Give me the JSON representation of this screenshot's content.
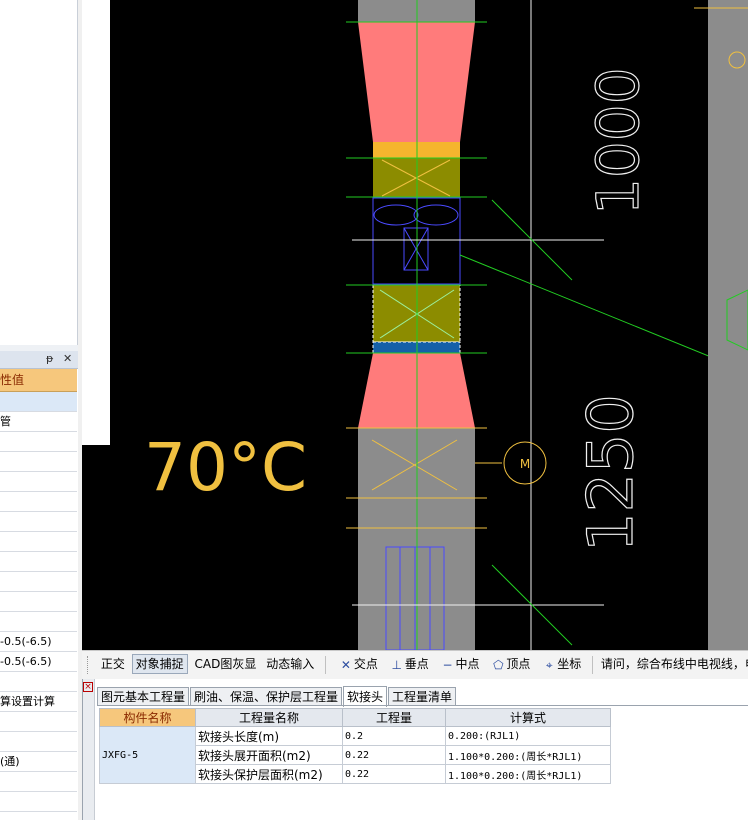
{
  "left_panel": {
    "title_pin_icon": "pin-icon",
    "title_close_icon": "close-icon",
    "title_pin_glyph": "ᵽ",
    "title_close_glyph": "✕",
    "header": "属性值",
    "rows": [
      "",
      "管",
      "",
      "",
      "",
      "",
      "",
      "",
      "",
      "",
      "",
      "",
      "-0.5(-6.5)",
      "-0.5(-6.5)",
      "",
      "算设置计算",
      "",
      "",
      "(通)",
      "",
      ""
    ]
  },
  "canvas": {
    "temp_label": "70°C",
    "dim_upper": "1000",
    "dim_lower": "1250"
  },
  "toolbar": {
    "ortho": "正交",
    "snap": "对象捕捉",
    "cad_gray": "CAD图灰显",
    "dynamic_input": "动态输入",
    "intersection": "交点",
    "perpendicular": "垂点",
    "midpoint": "中点",
    "vertex": "顶点",
    "coordinate": "坐标",
    "intersection_icon": "intersection-icon",
    "perpendicular_icon": "perpendicular-icon",
    "midpoint_icon": "midpoint-icon",
    "vertex_icon": "vertex-icon",
    "coordinate_icon": "coordinate-icon",
    "status": "请问，综合布线中电视线，电"
  },
  "bottom_panel": {
    "tabs": [
      "图元基本工程量",
      "刷油、保温、保护层工程量",
      "软接头",
      "工程量清单"
    ],
    "active_tab": "软接头",
    "table": {
      "headers": [
        "构件名称",
        "工程量名称",
        "工程量",
        "计算式"
      ],
      "component": "JXFG-5",
      "rows": [
        {
          "name": "软接头长度(m)",
          "qty": "0.2",
          "formula": "0.200:(RJL1)"
        },
        {
          "name": "软接头展开面积(m2)",
          "qty": "0.22",
          "formula": "1.100*0.200:(周长*RJL1)"
        },
        {
          "name": "软接头保护层面积(m2)",
          "qty": "0.22",
          "formula": "1.100*0.200:(周长*RJL1)"
        }
      ]
    }
  },
  "colors": {
    "canvas_bg": "#000000",
    "duct_gray": "#8c8c8c",
    "salmon": "#ff7b7b",
    "olive": "#8c8c00",
    "cad_line": "#f0f0f0",
    "cad_green": "#22cc22",
    "cad_yellow": "#f0c040",
    "cad_blue": "#4a4aff",
    "selection_header": "#f6c77c"
  }
}
